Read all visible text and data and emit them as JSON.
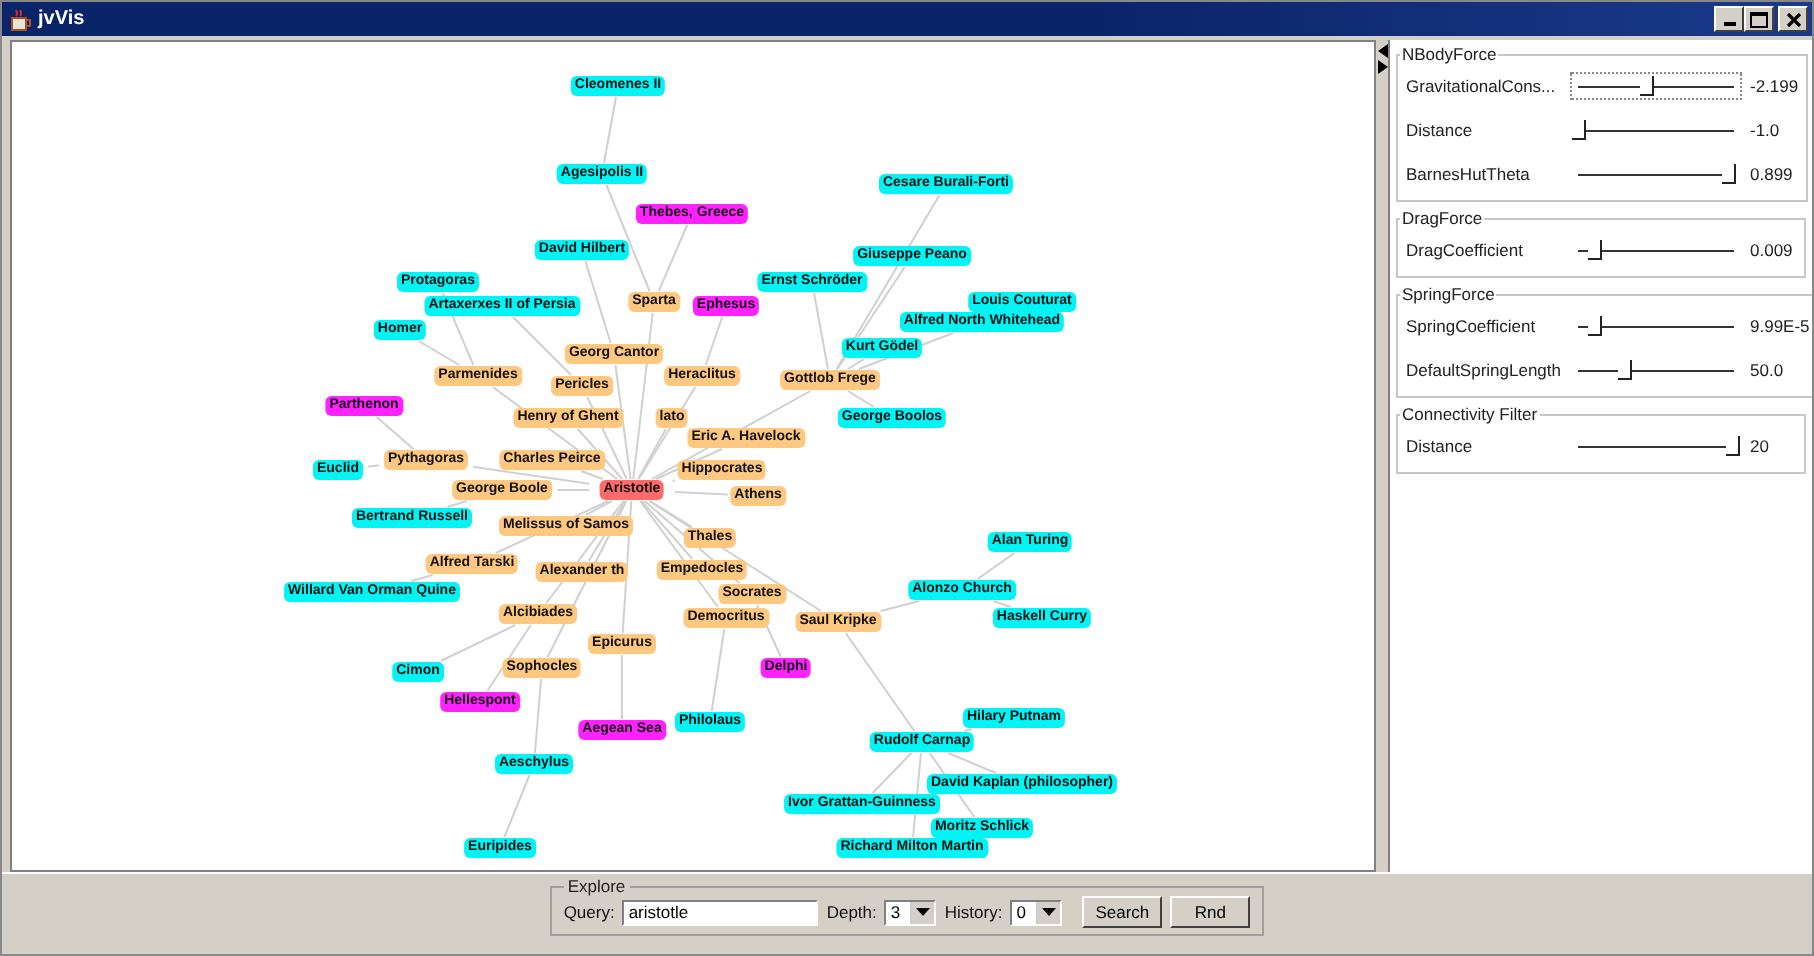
{
  "window": {
    "title": "jvVis"
  },
  "graph": {
    "nodes": [
      {
        "label": "Cleomenes II",
        "color": "#00f4f4"
      },
      {
        "label": "Agesipolis II",
        "color": "#00f4f4"
      },
      {
        "label": "Cesare Burali-Forti",
        "color": "#00f4f4"
      },
      {
        "label": "Thebes, Greece",
        "color": "#ff22ff"
      },
      {
        "label": "David Hilbert",
        "color": "#00f4f4"
      },
      {
        "label": "Giuseppe Peano",
        "color": "#00f4f4"
      },
      {
        "label": "Protagoras",
        "color": "#00f4f4"
      },
      {
        "label": "Ernst Schröder",
        "color": "#00f4f4"
      },
      {
        "label": "Artaxerxes II of Persia",
        "color": "#00f4f4"
      },
      {
        "label": "Sparta",
        "color": "#ffc880"
      },
      {
        "label": "Ephesus",
        "color": "#ff22ff"
      },
      {
        "label": "Louis Couturat",
        "color": "#00f4f4"
      },
      {
        "label": "Homer",
        "color": "#00f4f4"
      },
      {
        "label": "Alfred North Whitehead",
        "color": "#00f4f4"
      },
      {
        "label": "Georg Cantor",
        "color": "#ffc880"
      },
      {
        "label": "Kurt Gödel",
        "color": "#00f4f4"
      },
      {
        "label": "Parmenides",
        "color": "#ffc880"
      },
      {
        "label": "Pericles",
        "color": "#ffc880"
      },
      {
        "label": "Heraclitus",
        "color": "#ffc880"
      },
      {
        "label": "Gottlob Frege",
        "color": "#ffc880"
      },
      {
        "label": "Parthenon",
        "color": "#ff22ff"
      },
      {
        "label": "Henry of Ghent",
        "color": "#ffc880"
      },
      {
        "label": "lato",
        "color": "#ffc880"
      },
      {
        "label": "George Boolos",
        "color": "#00f4f4"
      },
      {
        "label": "Eric A. Havelock",
        "color": "#ffc880"
      },
      {
        "label": "Euclid",
        "color": "#00f4f4"
      },
      {
        "label": "Pythagoras",
        "color": "#ffc880"
      },
      {
        "label": "Charles Peirce",
        "color": "#ffc880"
      },
      {
        "label": "Hippocrates",
        "color": "#ffc880"
      },
      {
        "label": "George Boole",
        "color": "#ffc880"
      },
      {
        "label": "Aristotle",
        "color": "#ff6a6a"
      },
      {
        "label": "Athens",
        "color": "#ffc880"
      },
      {
        "label": "Bertrand Russell",
        "color": "#00f4f4"
      },
      {
        "label": "Melissus of Samos",
        "color": "#ffc880"
      },
      {
        "label": "Thales",
        "color": "#ffc880"
      },
      {
        "label": "Alan Turing",
        "color": "#00f4f4"
      },
      {
        "label": "Alfred Tarski",
        "color": "#ffc880"
      },
      {
        "label": "Alexander th",
        "color": "#ffc880"
      },
      {
        "label": "Empedocles",
        "color": "#ffc880"
      },
      {
        "label": "Willard Van Orman Quine",
        "color": "#00f4f4"
      },
      {
        "label": "Socrates",
        "color": "#ffc880"
      },
      {
        "label": "Alonzo Church",
        "color": "#00f4f4"
      },
      {
        "label": "Alcibiades",
        "color": "#ffc880"
      },
      {
        "label": "Democritus",
        "color": "#ffc880"
      },
      {
        "label": "Saul Kripke",
        "color": "#ffc880"
      },
      {
        "label": "Haskell Curry",
        "color": "#00f4f4"
      },
      {
        "label": "Epicurus",
        "color": "#ffc880"
      },
      {
        "label": "Cimon",
        "color": "#00f4f4"
      },
      {
        "label": "Sophocles",
        "color": "#ffc880"
      },
      {
        "label": "Delphi",
        "color": "#ff22ff"
      },
      {
        "label": "Hellespont",
        "color": "#ff22ff"
      },
      {
        "label": "Aegean Sea",
        "color": "#ff22ff"
      },
      {
        "label": "Philolaus",
        "color": "#00f4f4"
      },
      {
        "label": "Hilary Putnam",
        "color": "#00f4f4"
      },
      {
        "label": "Rudolf Carnap",
        "color": "#00f4f4"
      },
      {
        "label": "Aeschylus",
        "color": "#00f4f4"
      },
      {
        "label": "David Kaplan (philosopher)",
        "color": "#00f4f4"
      },
      {
        "label": "Ivor Grattan-Guinness",
        "color": "#00f4f4"
      },
      {
        "label": "Moritz Schlick",
        "color": "#00f4f4"
      },
      {
        "label": "Euripides",
        "color": "#00f4f4"
      },
      {
        "label": "Richard Milton Martin",
        "color": "#00f4f4"
      }
    ]
  },
  "force_panel": {
    "groups": [
      {
        "title": "NBodyForce",
        "params": [
          {
            "label": "GravitationalCons...",
            "level": 0.44,
            "reading": "-2.199",
            "focused": true
          },
          {
            "label": "Distance",
            "level": 0.0,
            "reading": "-1.0",
            "focused": false
          },
          {
            "label": "BarnesHutTheta",
            "level": 0.97,
            "reading": "0.899",
            "focused": false
          }
        ]
      },
      {
        "title": "DragForce",
        "params": [
          {
            "label": "DragCoefficient",
            "level": 0.1,
            "reading": "0.009",
            "focused": false
          }
        ]
      },
      {
        "title": "SpringForce",
        "params": [
          {
            "label": "SpringCoefficient",
            "level": 0.1,
            "reading": "9.99E-5",
            "focused": false
          },
          {
            "label": "DefaultSpringLength",
            "level": 0.3,
            "reading": "50.0",
            "focused": false
          }
        ]
      },
      {
        "title": "Connectivity Filter",
        "params": [
          {
            "label": "Distance",
            "level": 1.0,
            "reading": "20",
            "focused": false
          }
        ]
      }
    ]
  },
  "explore": {
    "title": "Explore",
    "query_label": "Query:",
    "query": "aristotle",
    "depth_label": "Depth:",
    "depth": "3",
    "history_label": "History:",
    "history": "0",
    "buttons": [
      "Search",
      "Rnd"
    ]
  }
}
